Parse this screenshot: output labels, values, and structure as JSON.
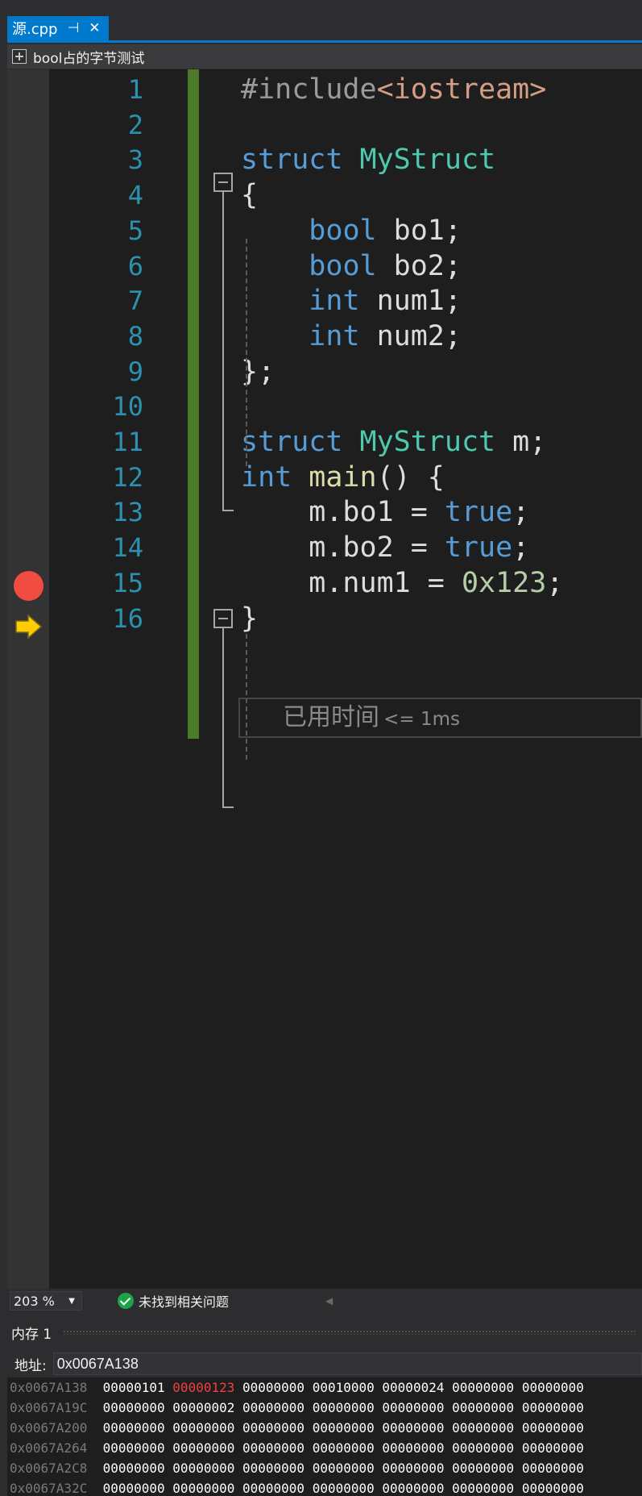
{
  "tab": {
    "title": "源.cpp",
    "pin_glyph": "⊣",
    "close_glyph": "✕"
  },
  "navbar": {
    "project": "bool占的字节测试"
  },
  "editor": {
    "line_numbers": [
      "1",
      "2",
      "3",
      "4",
      "5",
      "6",
      "7",
      "8",
      "9",
      "10",
      "11",
      "12",
      "13",
      "14",
      "15",
      "16"
    ],
    "lines": [
      [
        {
          "t": "#include",
          "c": "pp"
        },
        {
          "t": "<iostream>",
          "c": "str"
        }
      ],
      [],
      [
        {
          "t": "struct ",
          "c": "kw"
        },
        {
          "t": "MyStruct",
          "c": "ty"
        }
      ],
      [
        {
          "t": "{",
          "c": "plain"
        }
      ],
      [
        {
          "t": "    ",
          "c": "plain"
        },
        {
          "t": "bool",
          "c": "kw"
        },
        {
          "t": " bo1;",
          "c": "plain"
        }
      ],
      [
        {
          "t": "    ",
          "c": "plain"
        },
        {
          "t": "bool",
          "c": "kw"
        },
        {
          "t": " bo2;",
          "c": "plain"
        }
      ],
      [
        {
          "t": "    ",
          "c": "plain"
        },
        {
          "t": "int",
          "c": "kw"
        },
        {
          "t": " num1;",
          "c": "plain"
        }
      ],
      [
        {
          "t": "    ",
          "c": "plain"
        },
        {
          "t": "int",
          "c": "kw"
        },
        {
          "t": " num2;",
          "c": "plain"
        }
      ],
      [
        {
          "t": "};",
          "c": "plain"
        }
      ],
      [],
      [
        {
          "t": "struct ",
          "c": "kw"
        },
        {
          "t": "MyStruct",
          "c": "ty"
        },
        {
          "t": " m;",
          "c": "plain"
        }
      ],
      [
        {
          "t": "int ",
          "c": "kw"
        },
        {
          "t": "main",
          "c": "fn"
        },
        {
          "t": "() {",
          "c": "plain"
        }
      ],
      [
        {
          "t": "    m.bo1 = ",
          "c": "plain"
        },
        {
          "t": "true",
          "c": "kw"
        },
        {
          "t": ";",
          "c": "plain"
        }
      ],
      [
        {
          "t": "    m.bo2 = ",
          "c": "plain"
        },
        {
          "t": "true",
          "c": "kw"
        },
        {
          "t": ";",
          "c": "plain"
        }
      ],
      [
        {
          "t": "    m.num1 = ",
          "c": "plain"
        },
        {
          "t": "0x123",
          "c": "num"
        },
        {
          "t": ";",
          "c": "plain"
        }
      ],
      [
        {
          "t": "}",
          "c": "plain"
        }
      ]
    ],
    "breakpoint_line": 13,
    "current_line": 16,
    "elapsed_label": "已用时间",
    "elapsed_value": "<= 1ms",
    "colors": {
      "breakpoint": "#f04c42",
      "current_arrow": "#ffcc00",
      "change_bar": "#4b7b2a"
    },
    "icons": [
      "breakpoint-icon",
      "current-statement-arrow-icon",
      "collapse-icon"
    ]
  },
  "status": {
    "zoom": "203 %",
    "issues": "未找到相关问题",
    "issues_icon": "check-circle-icon"
  },
  "memory": {
    "title": "内存 1",
    "address_label": "地址:",
    "address_value": "0x0067A138",
    "rows": [
      {
        "addr": "0x0067A138",
        "vals": [
          "00000101",
          "00000123",
          "00000000",
          "00010000",
          "00000024",
          "00000000",
          "00000000"
        ],
        "changed": [
          1
        ]
      },
      {
        "addr": "0x0067A19C",
        "vals": [
          "00000000",
          "00000002",
          "00000000",
          "00000000",
          "00000000",
          "00000000",
          "00000000"
        ],
        "changed": []
      },
      {
        "addr": "0x0067A200",
        "vals": [
          "00000000",
          "00000000",
          "00000000",
          "00000000",
          "00000000",
          "00000000",
          "00000000"
        ],
        "changed": []
      },
      {
        "addr": "0x0067A264",
        "vals": [
          "00000000",
          "00000000",
          "00000000",
          "00000000",
          "00000000",
          "00000000",
          "00000000"
        ],
        "changed": []
      },
      {
        "addr": "0x0067A2C8",
        "vals": [
          "00000000",
          "00000000",
          "00000000",
          "00000000",
          "00000000",
          "00000000",
          "00000000"
        ],
        "changed": []
      },
      {
        "addr": "0x0067A32C",
        "vals": [
          "00000000",
          "00000000",
          "00000000",
          "00000000",
          "00000000",
          "00000000",
          "00000000"
        ],
        "changed": []
      }
    ]
  }
}
